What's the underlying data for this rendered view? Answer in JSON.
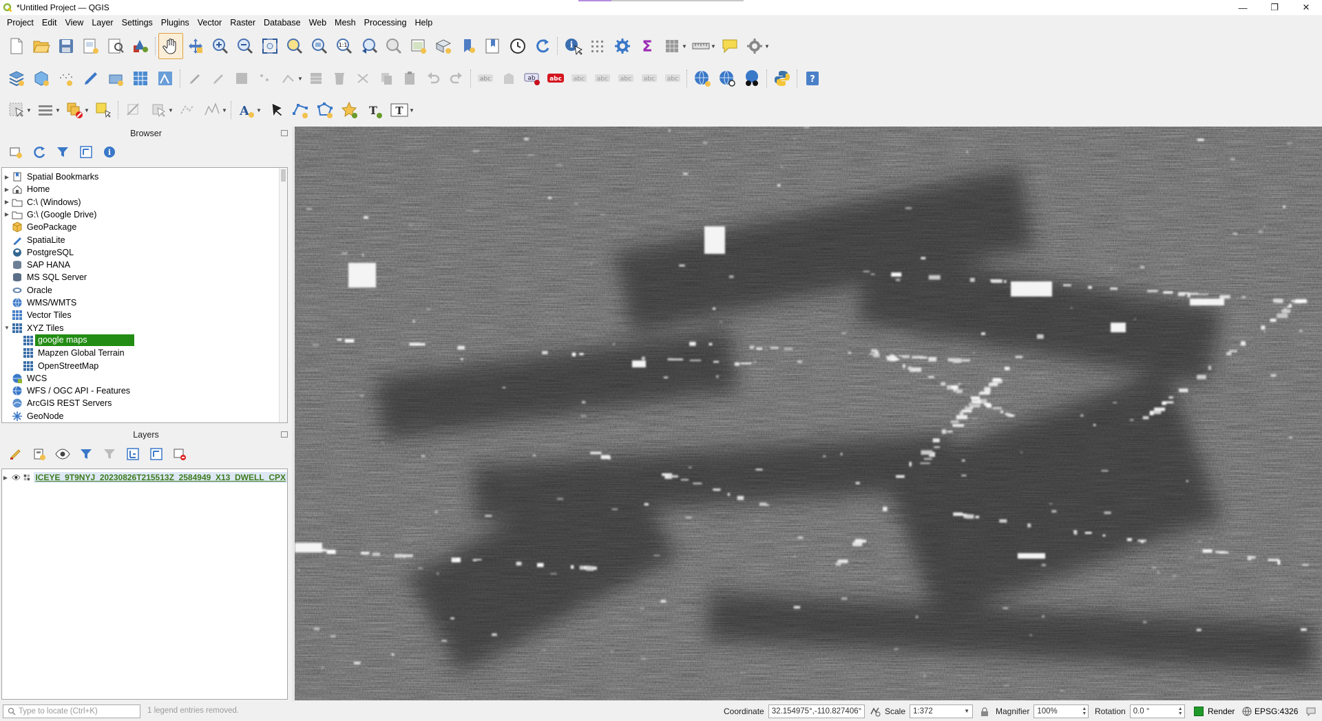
{
  "window": {
    "title": "*Untitled Project — QGIS",
    "controls": {
      "minimize": "—",
      "maximize": "❐",
      "close": "✕"
    }
  },
  "menubar": {
    "items": [
      "Project",
      "Edit",
      "View",
      "Layer",
      "Settings",
      "Plugins",
      "Vector",
      "Raster",
      "Database",
      "Web",
      "Mesh",
      "Processing",
      "Help"
    ]
  },
  "browser": {
    "title": "Browser",
    "items": [
      {
        "label": "Spatial Bookmarks",
        "icon": "bookmark-icon",
        "expandable": true
      },
      {
        "label": "Home",
        "icon": "home-folder-icon",
        "expandable": true
      },
      {
        "label": "C:\\ (Windows)",
        "icon": "folder-icon",
        "expandable": true
      },
      {
        "label": "G:\\ (Google Drive)",
        "icon": "folder-icon",
        "expandable": true
      },
      {
        "label": "GeoPackage",
        "icon": "geopackage-icon",
        "expandable": false
      },
      {
        "label": "SpatiaLite",
        "icon": "spatialite-icon",
        "expandable": false
      },
      {
        "label": "PostgreSQL",
        "icon": "postgresql-icon",
        "expandable": false
      },
      {
        "label": "SAP HANA",
        "icon": "sap-hana-icon",
        "expandable": false
      },
      {
        "label": "MS SQL Server",
        "icon": "mssql-icon",
        "expandable": false
      },
      {
        "label": "Oracle",
        "icon": "oracle-icon",
        "expandable": false
      },
      {
        "label": "WMS/WMTS",
        "icon": "wms-globe-icon",
        "expandable": false
      },
      {
        "label": "Vector Tiles",
        "icon": "vector-tiles-icon",
        "expandable": false
      },
      {
        "label": "XYZ Tiles",
        "icon": "xyz-tiles-icon",
        "expandable": true,
        "expanded": true
      },
      {
        "label": "google maps",
        "icon": "xyz-tiles-icon",
        "child": true,
        "selected": true
      },
      {
        "label": "Mapzen Global Terrain",
        "icon": "xyz-tiles-icon",
        "child": true
      },
      {
        "label": "OpenStreetMap",
        "icon": "xyz-tiles-icon",
        "child": true
      },
      {
        "label": "WCS",
        "icon": "wcs-icon",
        "expandable": false
      },
      {
        "label": "WFS / OGC API - Features",
        "icon": "wfs-icon",
        "expandable": false
      },
      {
        "label": "ArcGIS REST Servers",
        "icon": "arcgis-icon",
        "expandable": false
      },
      {
        "label": "GeoNode",
        "icon": "geonode-icon",
        "expandable": false
      }
    ]
  },
  "layers": {
    "title": "Layers",
    "items": [
      {
        "name": "ICEYE_9T9NYJ_20230826T215513Z_2584949_X13_DWELL_CPX",
        "visible": true
      }
    ]
  },
  "statusbar": {
    "locator_placeholder": "Type to locate (Ctrl+K)",
    "message": "1 legend entries removed.",
    "coordinate_label": "Coordinate",
    "coordinate_value": "32.154975°,-110.827406°",
    "scale_label": "Scale",
    "scale_value": "1:372",
    "magnifier_label": "Magnifier",
    "magnifier_value": "100%",
    "rotation_label": "Rotation",
    "rotation_value": "0.0 °",
    "render_label": "Render",
    "crs_label": "EPSG:4326"
  },
  "colors": {
    "selected_item": "#238c14",
    "layer_name": "#3d7a1c",
    "canvas_bg": "#3a3a3a"
  }
}
